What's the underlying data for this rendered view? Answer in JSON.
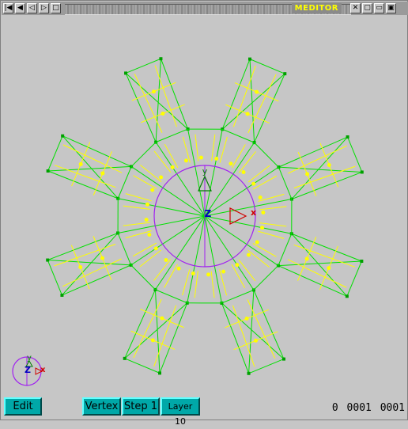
{
  "window": {
    "title": "MEDITOR",
    "titlebar_buttons_left": [
      "|◀",
      "◀",
      "◁",
      "▷",
      "□"
    ],
    "titlebar_buttons_right": [
      "✕",
      "▢",
      "▭",
      "▣"
    ]
  },
  "viewport": {
    "axis_labels": {
      "x": "x",
      "y": "y",
      "z": "Z"
    },
    "mini_axes": {
      "x": "x",
      "y": "y",
      "z": "Z"
    },
    "colors": {
      "background": "#c6c6c6",
      "edges": "#00e000",
      "vertices": "#00a000",
      "guides": "#ffff00",
      "circle": "#a020f0",
      "axis_x": "#d00000",
      "axis_y": "#00a000",
      "axis_z": "#0000c0"
    },
    "petal_count": 8
  },
  "toolbar": {
    "edit_label": "Edit",
    "vertex_label": "Vertex",
    "step_label": "Step 1",
    "layer_label": "Layer 10"
  },
  "status": {
    "value_a": "0",
    "value_b": "0001",
    "value_c": "0001"
  }
}
